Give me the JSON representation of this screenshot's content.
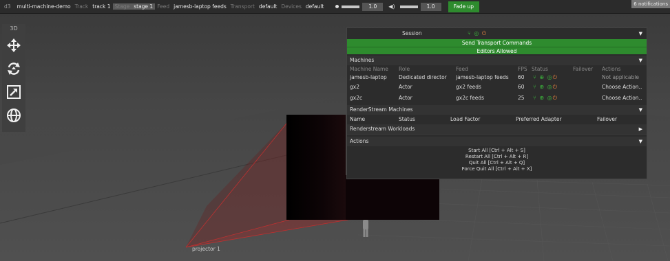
{
  "topbar": {
    "app_name": "d3",
    "project": "multi-machine-demo",
    "track_label": "Track",
    "track_value": "track 1",
    "stage_label": "Stage",
    "stage_value": "stage 1",
    "feed_label": "Feed",
    "feed_value": "jamesb-laptop feeds",
    "transport_label": "Transport",
    "transport_value": "default",
    "devices_label": "Devices",
    "devices_value": "default",
    "brightness_value": "1.0",
    "volume_value": "1.0",
    "fade_label": "Fade up",
    "notifications": "6 notifications"
  },
  "toolbar": {
    "mode_label": "3D",
    "tools": [
      "move-icon",
      "rotate-icon",
      "scale-icon",
      "globe-icon"
    ]
  },
  "scene": {
    "projector_label": "projector 1"
  },
  "session": {
    "title": "Session",
    "send_transport": "Send Transport Commands",
    "editors_allowed": "Editors Allowed",
    "machines": {
      "title": "Machines",
      "headers": [
        "Machine Name",
        "Role",
        "Feed",
        "FPS",
        "Status",
        "Failover",
        "Actions"
      ],
      "rows": [
        {
          "name": "jamesb-laptop",
          "role": "Dedicated director",
          "feed": "jamesb-laptop feeds",
          "fps": "60",
          "action": "Not applicable"
        },
        {
          "name": "gx2",
          "role": "Actor",
          "feed": "gx2 feeds",
          "fps": "60",
          "action": "Choose Action.."
        },
        {
          "name": "gx2c",
          "role": "Actor",
          "feed": "gx2c feeds",
          "fps": "25",
          "action": "Choose Action.."
        }
      ]
    },
    "renderstream": {
      "title": "RenderStream Machines",
      "headers": [
        "Name",
        "Status",
        "Load Factor",
        "Preferred Adapter",
        "Failover"
      ]
    },
    "workloads": {
      "title": "Renderstream Workloads"
    },
    "actions": {
      "title": "Actions",
      "items": [
        "Start All [Ctrl + Alt + S]",
        "Restart All [Ctrl + Alt + R]",
        "Quit All [Ctrl + Alt + Q]",
        "Force Quit All [Ctrl + Alt + X]"
      ]
    }
  },
  "colors": {
    "accent_green": "#2e8b2e",
    "status_green": "#3cb43c",
    "status_orange": "#e08040"
  }
}
